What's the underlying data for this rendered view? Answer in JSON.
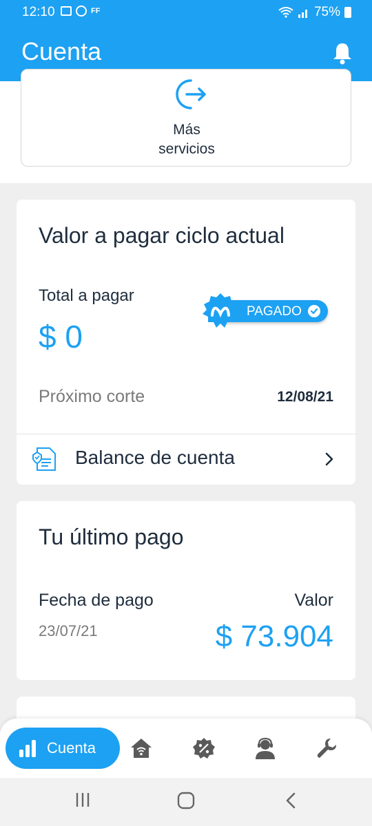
{
  "status_bar": {
    "time": "12:10",
    "icons_left": [
      "gallery-icon",
      "whatsapp-icon",
      "ff-icon"
    ],
    "ff_text": "FF",
    "battery": "75%"
  },
  "app_bar": {
    "title": "Cuenta"
  },
  "more_services": {
    "label": "Más servicios"
  },
  "current_cycle": {
    "title": "Valor a pagar ciclo actual",
    "total_label": "Total a pagar",
    "total_amount": "$ 0",
    "status_badge": "PAGADO",
    "next_cut_label": "Próximo corte",
    "next_cut_date": "12/08/21",
    "balance_link": "Balance de cuenta"
  },
  "last_payment": {
    "title": "Tu último pago",
    "date_label": "Fecha de pago",
    "date_value": "23/07/21",
    "value_label": "Valor",
    "value_amount": "$ 73.904"
  },
  "bottom_nav": {
    "active_label": "Cuenta",
    "items": [
      "chart-icon",
      "home-wifi-icon",
      "discount-icon",
      "support-agent-icon",
      "wrench-icon"
    ]
  },
  "colors": {
    "brand_blue": "#1da1f2",
    "text_dark": "#1f2d3d",
    "text_gray": "#7a7a7a"
  }
}
